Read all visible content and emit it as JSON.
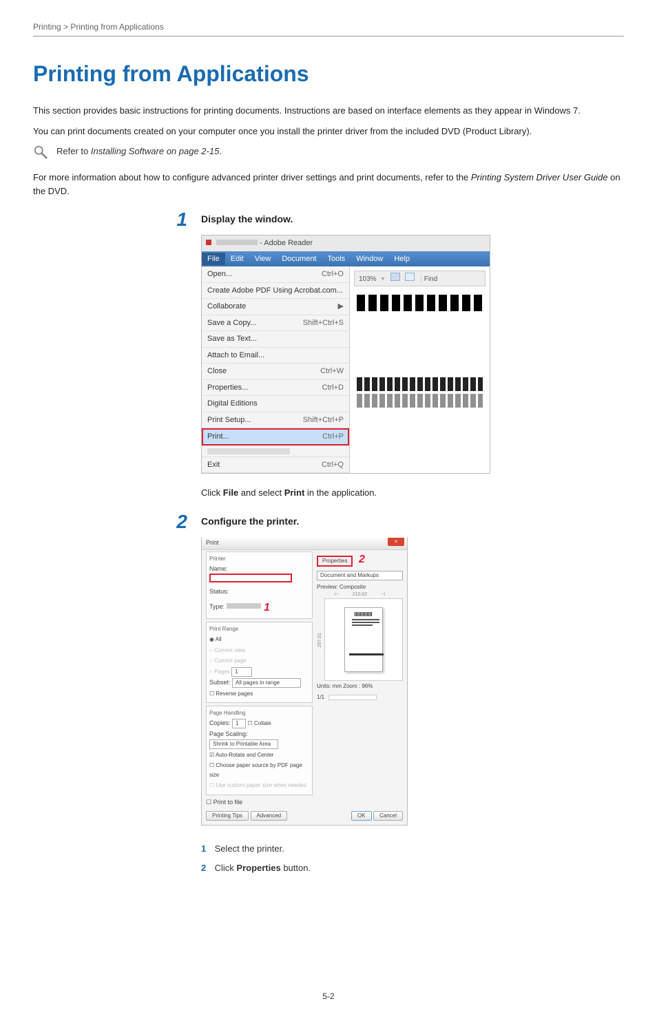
{
  "breadcrumb": "Printing > Printing from Applications",
  "h1": "Printing from Applications",
  "p1": "This section provides basic instructions for printing documents. Instructions are based on interface elements as they appear in Windows 7.",
  "p2": "You can print documents created on your computer once you install the printer driver from the included DVD (Product Library).",
  "ref_prefix": "Refer to ",
  "ref_link": "Installing Software on page 2-15",
  "ref_suffix": ".",
  "p3_a": "For more information about how to configure advanced printer driver settings and print documents, refer to the ",
  "p3_b": "Printing System Driver User Guide",
  "p3_c": " on the DVD.",
  "step1": {
    "num": "1",
    "heading": "Display the window.",
    "caption_a": "Click ",
    "caption_b": "File",
    "caption_c": " and select ",
    "caption_d": "Print",
    "caption_e": " in the application.",
    "shot": {
      "title_suffix": " - Adobe Reader",
      "menubar": [
        "File",
        "Edit",
        "View",
        "Document",
        "Tools",
        "Window",
        "Help"
      ],
      "menu": [
        {
          "label": "Open...",
          "shortcut": "Ctrl+O"
        },
        {
          "label": "Create Adobe PDF Using Acrobat.com...",
          "shortcut": ""
        },
        {
          "label": "Collaborate",
          "shortcut": "▶"
        },
        {
          "label": "Save a Copy...",
          "shortcut": "Shift+Ctrl+S"
        },
        {
          "label": "Save as Text...",
          "shortcut": ""
        },
        {
          "label": "Attach to Email...",
          "shortcut": ""
        },
        {
          "label": "Close",
          "shortcut": "Ctrl+W"
        },
        {
          "label": "Properties...",
          "shortcut": "Ctrl+D"
        },
        {
          "label": "Digital Editions",
          "shortcut": ""
        },
        {
          "label": "Print Setup...",
          "shortcut": "Shift+Ctrl+P"
        },
        {
          "label": "Print...",
          "shortcut": "Ctrl+P",
          "selected": true
        },
        {
          "label": "Exit",
          "shortcut": "Ctrl+Q"
        }
      ],
      "toolbar_zoom": "103%",
      "toolbar_find": "Find"
    }
  },
  "step2": {
    "num": "2",
    "heading": "Configure the printer.",
    "shot": {
      "title": "Print",
      "printer": {
        "group": "Printer",
        "name_label": "Name:",
        "status_label": "Status:",
        "type_label": "Type:",
        "properties_btn": "Properties",
        "comments_sel": "Document and Markups"
      },
      "range": {
        "group": "Print Range",
        "all": "All",
        "current_view": "Current view",
        "current_page": "Current page",
        "pages": "Pages",
        "pages_val": "1",
        "subset": "Subset:",
        "subset_val": "All pages in range",
        "reverse": "Reverse pages"
      },
      "handling": {
        "group": "Page Handling",
        "copies": "Copies:",
        "copies_val": "1",
        "collate": "Collate",
        "scaling": "Page Scaling:",
        "scaling_val": "Shrink to Printable Area",
        "auto_rotate": "Auto-Rotate and Center",
        "choose_source": "Choose paper source by PDF page size",
        "custom_paper": "Use custom paper size when needed"
      },
      "preview": {
        "label": "Preview: Composite",
        "width": "210.02",
        "height": "297.01",
        "units": "Units: mm Zoom : 96%",
        "page": "1/1"
      },
      "print_to_file": "Print to file",
      "tips_btn": "Printing Tips",
      "advanced_btn": "Advanced",
      "ok_btn": "OK",
      "cancel_btn": "Cancel"
    },
    "list": {
      "n1": "1",
      "t1": "Select the printer.",
      "n2": "2",
      "t2_a": "Click ",
      "t2_b": "Properties",
      "t2_c": " button."
    }
  },
  "page_num": "5-2"
}
